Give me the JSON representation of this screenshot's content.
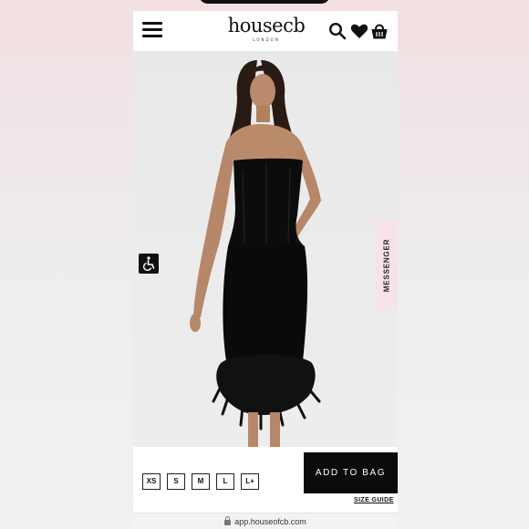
{
  "brand": {
    "logo_text": "housecb",
    "logo_subtext": "LONDON"
  },
  "header": {
    "menu_icon": "hamburger-menu-icon",
    "search_icon": "search-icon",
    "wishlist_icon": "heart-icon",
    "bag_icon": "shopping-bag-icon"
  },
  "product": {
    "image": "model-black-strapless-corset-dress-feather-hem",
    "messenger_label": "MESSENGER",
    "accessibility_icon": "wheelchair-icon"
  },
  "sizes": [
    "XS",
    "S",
    "M",
    "L",
    "L+"
  ],
  "actions": {
    "add_to_bag": "ADD TO BAG",
    "size_guide": "SIZE GUIDE"
  },
  "browser": {
    "url": "app.houseofcb.com"
  },
  "colors": {
    "accent": "#0b0b0b",
    "messenger_bg": "#f7e4e8",
    "page_bg_top": "#f3dfe2"
  }
}
